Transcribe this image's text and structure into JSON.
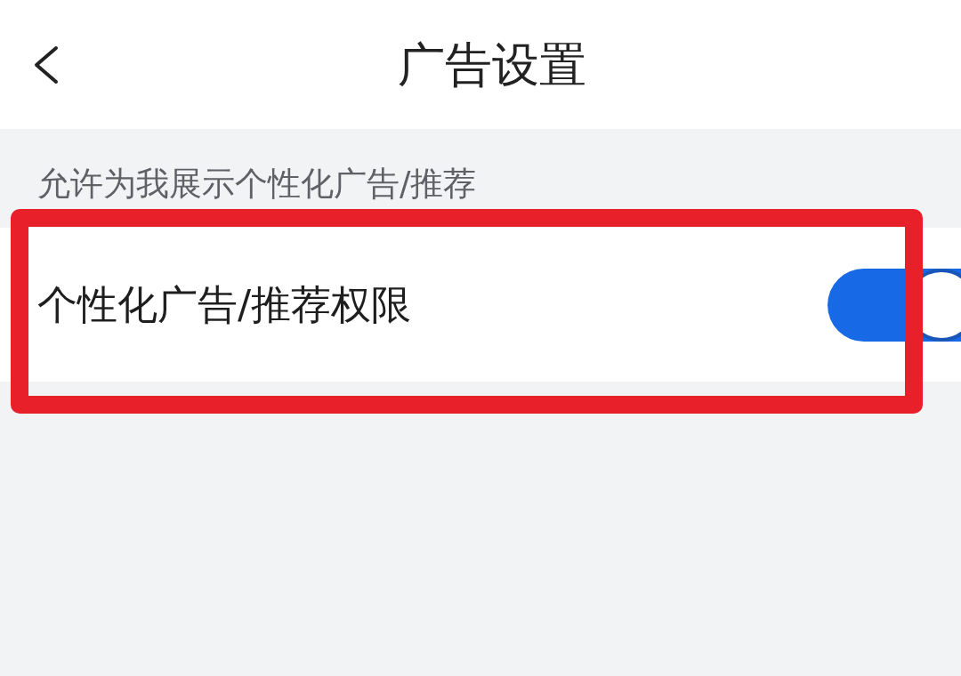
{
  "header": {
    "title": "广告设置"
  },
  "section": {
    "label": "允许为我展示个性化广告/推荐"
  },
  "settings": [
    {
      "label": "个性化广告/推荐权限",
      "on": true,
      "highlighted": true
    }
  ]
}
